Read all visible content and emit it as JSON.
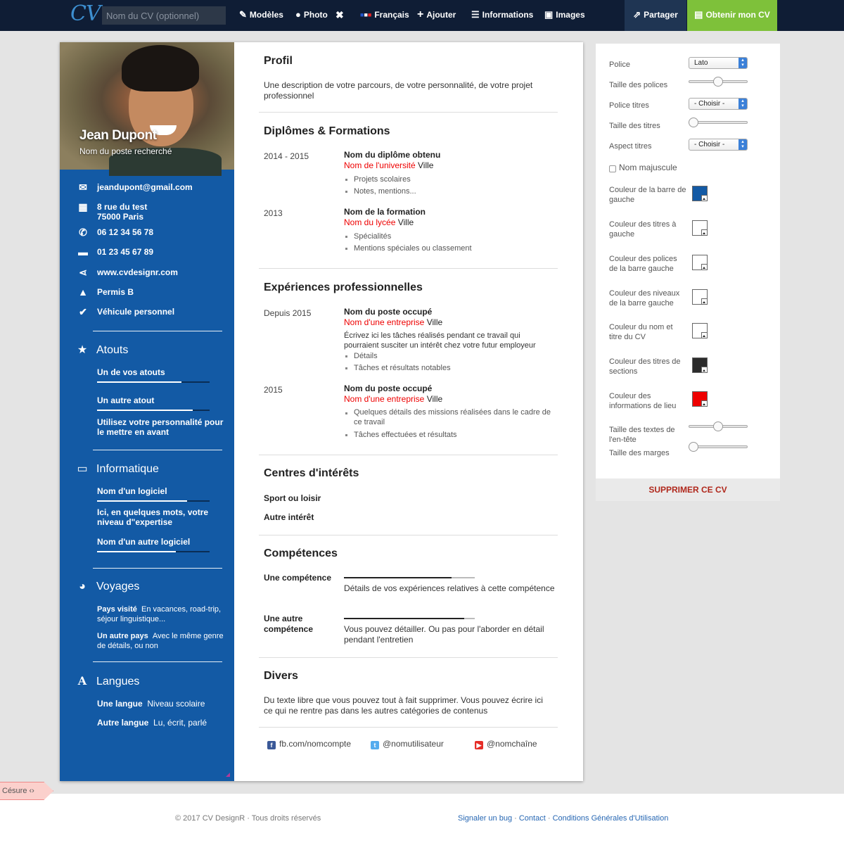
{
  "topbar": {
    "logo": "CV",
    "cv_name_placeholder": "Nom du CV (optionnel)",
    "nav": {
      "models": "Modèles",
      "photo": "Photo",
      "language": "Français",
      "add": "Ajouter",
      "info": "Informations",
      "images": "Images",
      "share": "Partager",
      "get_cv": "Obtenir mon CV"
    }
  },
  "profile": {
    "name": "Jean Dupont",
    "title": "Nom du poste recherché"
  },
  "contact": {
    "email": "jeandupont@gmail.com",
    "address_line1": "8 rue du test",
    "address_line2": "75000 Paris",
    "phone1": "06 12 34 56 78",
    "phone2": "01 23 45 67 89",
    "website": "www.cvdesignr.com",
    "license": "Permis B",
    "vehicle": "Véhicule personnel"
  },
  "sidebar": {
    "atouts": {
      "heading": "Atouts",
      "item1": "Un de vos atouts",
      "item1_level": 0.75,
      "item2": "Un autre atout",
      "item2_level": 0.85,
      "item3": "Utilisez votre personnalité pour le mettre en avant"
    },
    "informatique": {
      "heading": "Informatique",
      "item1": "Nom d'un logiciel",
      "item1_level": 0.8,
      "item1_desc": "Ici, en quelques mots, votre niveau d\"expertise",
      "item2": "Nom d'un autre logiciel",
      "item2_level": 0.7
    },
    "voyages": {
      "heading": "Voyages",
      "item1_name": "Pays visité",
      "item1_desc": "En vacances, road-trip, séjour linguistique...",
      "item2_name": "Un autre pays",
      "item2_desc": "Avec le même genre de détails, ou non"
    },
    "langues": {
      "heading": "Langues",
      "item1_name": "Une langue",
      "item1_level": "Niveau scolaire",
      "item2_name": "Autre langue",
      "item2_level": "Lu, écrit, parlé"
    }
  },
  "main": {
    "profil": {
      "heading": "Profil",
      "text": "Une description de votre parcours, de votre personnalité, de votre projet professionnel"
    },
    "diplomes": {
      "heading": "Diplômes & Formations",
      "entries": [
        {
          "date": "2014 - 2015",
          "title": "Nom du diplôme obtenu",
          "place": "Nom de l'université",
          "city": "Ville",
          "bullets": [
            "Projets scolaires",
            "Notes, mentions..."
          ]
        },
        {
          "date": "2013",
          "title": "Nom de la formation",
          "place": "Nom du lycée",
          "city": "Ville",
          "bullets": [
            "Spécialités",
            "Mentions spéciales ou classement"
          ]
        }
      ]
    },
    "experiences": {
      "heading": "Expériences professionnelles",
      "entries": [
        {
          "date": "Depuis 2015",
          "title": "Nom du poste occupé",
          "place": "Nom d'une entreprise",
          "city": "Ville",
          "desc": "Écrivez ici les tâches réalisés pendant ce travail qui pourraient susciter un intérêt chez votre futur employeur",
          "bullets": [
            "Détails",
            "Tâches et résultats notables"
          ]
        },
        {
          "date": "2015",
          "title": "Nom du poste occupé",
          "place": "Nom d'une entreprise",
          "city": "Ville",
          "bullets": [
            "Quelques détails des missions réalisées dans le cadre de ce travail",
            "Tâches effectuées et résultats"
          ]
        }
      ]
    },
    "interets": {
      "heading": "Centres d'intérêts",
      "item1": "Sport ou loisir",
      "item2": "Autre intérêt"
    },
    "competences": {
      "heading": "Compétences",
      "entries": [
        {
          "name": "Une compétence",
          "level": 0.82,
          "desc": "Détails de vos expériences relatives à cette compétence"
        },
        {
          "name": "Une autre compétence",
          "level": 0.92,
          "desc": "Vous pouvez détailler. Ou pas pour l'aborder en détail pendant l'entretien"
        }
      ]
    },
    "divers": {
      "heading": "Divers",
      "text": "Du texte libre que vous pouvez tout à fait supprimer. Vous pouvez écrire ici ce qui ne rentre pas dans les autres catégories de contenus"
    },
    "social": {
      "facebook": "fb.com/nomcompte",
      "twitter": "@nomutilisateur",
      "youtube": "@nomchaîne"
    }
  },
  "panel": {
    "police_label": "Police",
    "police_value": "Lato",
    "taille_polices_label": "Taille des polices",
    "taille_polices_level": 0.5,
    "police_titres_label": "Police titres",
    "police_titres_value": "- Choisir -",
    "taille_titres_label": "Taille des titres",
    "taille_titres_level": 0.0,
    "aspect_titres_label": "Aspect titres",
    "aspect_titres_value": "- Choisir -",
    "nom_majuscule_label": "Nom majuscule",
    "colors": [
      {
        "label": "Couleur de la barre de gauche",
        "value": "#135aa5"
      },
      {
        "label": "Couleur des titres à gauche",
        "value": "#ffffff"
      },
      {
        "label": "Couleur des polices de la barre gauche",
        "value": "#ffffff"
      },
      {
        "label": "Couleur des niveaux de la barre gauche",
        "value": "#ffffff"
      },
      {
        "label": "Couleur du nom et titre du CV",
        "value": "#ffffff"
      },
      {
        "label": "Couleur des titres de sections",
        "value": "#2b2b2b"
      },
      {
        "label": "Couleur des informations de lieu",
        "value": "#ee0000"
      }
    ],
    "taille_entete_label": "Taille des textes de l'en-tête",
    "taille_entete_level": 0.5,
    "taille_marges_label": "Taille des marges",
    "taille_marges_level": 0.0,
    "delete_label": "SUPPRIMER CE CV"
  },
  "footer": {
    "copyright": "© 2017 CV DesignR · Tous droits réservés",
    "bug": "Signaler un bug",
    "contact": "Contact",
    "cgu": "Conditions Générales d'Utilisation",
    "sep": "·"
  },
  "cesure": "Césure ‹›",
  "colors": {
    "topbar": "#0f1d35",
    "sidebar": "#135aa5",
    "get_cv_button": "#7ec13a",
    "place_red": "#ee0000"
  }
}
